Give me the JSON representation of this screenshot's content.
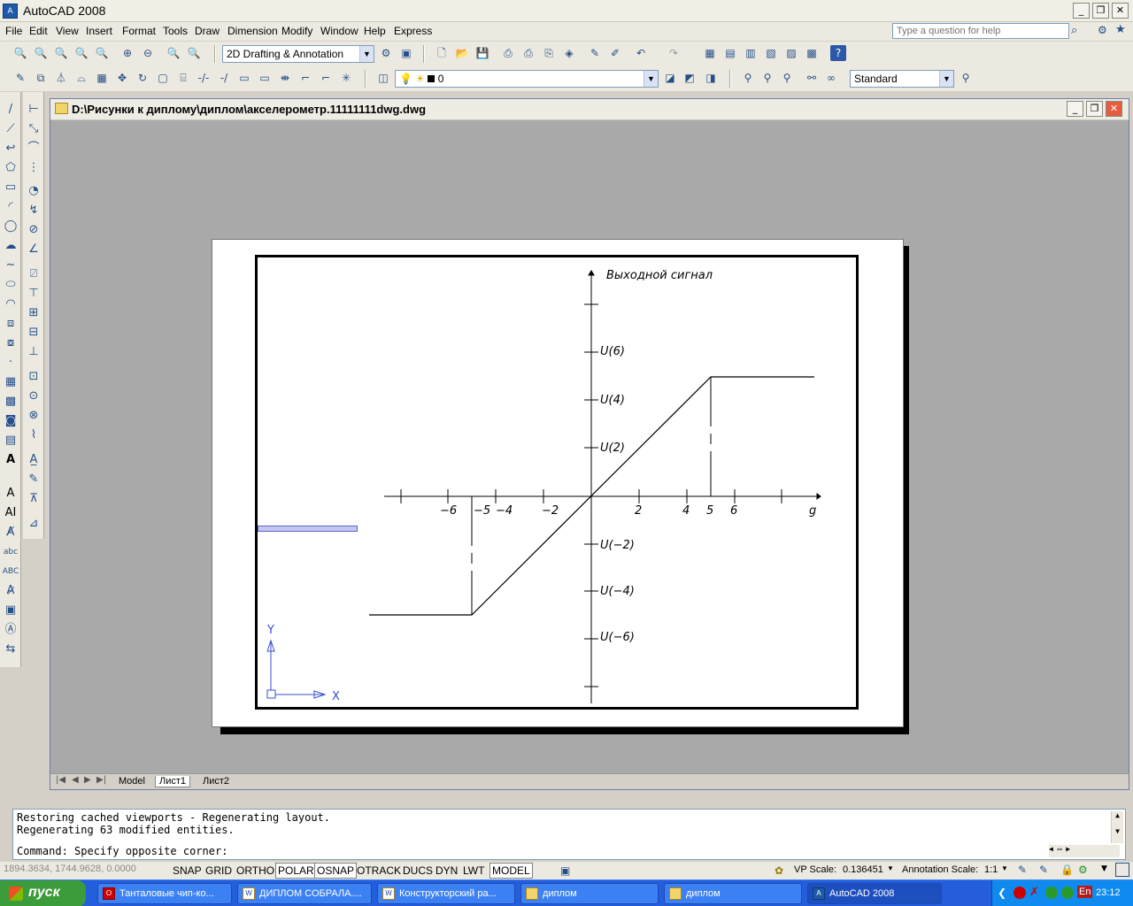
{
  "app": {
    "title": "AutoCAD 2008",
    "logo_text": "A"
  },
  "menu": [
    "File",
    "Edit",
    "View",
    "Insert",
    "Format",
    "Tools",
    "Draw",
    "Dimension",
    "Modify",
    "Window",
    "Help",
    "Express"
  ],
  "help_placeholder": "Type a question for help",
  "workspace": "2D Drafting & Annotation",
  "layer": "0",
  "style": "Standard",
  "document": {
    "title": "D:\\Рисунки к диплому\\диплом\\акселерометр.11111111dwg.dwg"
  },
  "drawing": {
    "ylabel": "Выходной сигнал",
    "x_ticks": [
      "−6",
      "−5",
      "−4",
      "−2",
      "2",
      "4",
      "5",
      "6",
      "g"
    ],
    "y_ticks_pos": [
      "U(6)",
      "U(4)",
      "U(2)"
    ],
    "y_ticks_neg": [
      "U(−2)",
      "U(−4)",
      "U(−6)"
    ],
    "ucs_x": "X",
    "ucs_y": "Y"
  },
  "tabs": [
    "Model",
    "Лист1",
    "Лист2"
  ],
  "command": {
    "history": [
      "Restoring cached viewports - Regenerating layout.",
      "Regenerating 63 modified entities."
    ],
    "prompt": "Command: Specify opposite corner:"
  },
  "status": {
    "coords": "1894.3634, 1744.9628, 0.0000",
    "buttons": [
      "SNAP",
      "GRID",
      "ORTHO",
      "POLAR",
      "OSNAP",
      "OTRACK",
      "DUCS",
      "DYN",
      "LWT",
      "MODEL"
    ],
    "on_buttons": [
      "POLAR",
      "OSNAP",
      "MODEL"
    ],
    "vp_scale_label": "VP Scale:",
    "vp_scale": "0.136451",
    "annotation_scale_label": "Annotation Scale:",
    "annotation_scale": "1:1"
  },
  "taskbar": {
    "start": "пуск",
    "tasks": [
      "Танталовые чип-ко...",
      "ДИПЛОМ СОБРАЛА....",
      "Конструкторский ра...",
      "диплом",
      "диплом",
      "AutoCAD 2008"
    ],
    "lang": "En",
    "clock": "23:12"
  },
  "colors": {
    "taskbar": "#245edb",
    "start": "#3c9b3a",
    "canvas": "#a9a9a9"
  }
}
